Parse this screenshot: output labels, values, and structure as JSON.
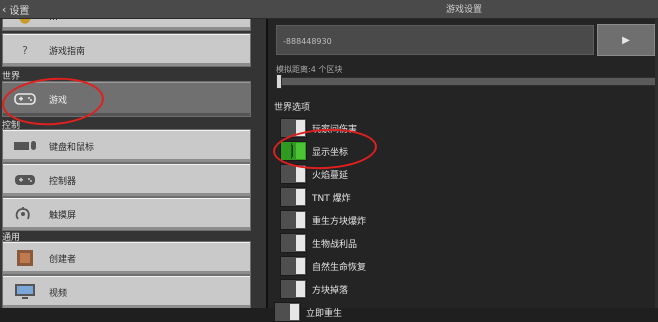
{
  "header": {
    "back_label": "设置",
    "title": "游戏设置"
  },
  "sidebar": {
    "partial_top": "…",
    "guide": "游戏指南",
    "section_world": "世界",
    "game": "游戏",
    "section_control": "控制",
    "keyboard_mouse": "键盘和鼠标",
    "controller": "控制器",
    "touchscreen": "触摸屏",
    "section_general": "通用",
    "creator": "创建者",
    "video": "视频"
  },
  "main": {
    "seed_value": "-888448930",
    "sim_distance_label": "模拟距离:4 个区块",
    "sim_distance_value": 0,
    "world_options_label": "世界选项",
    "options": [
      {
        "label": "玩家间伤害",
        "on": false
      },
      {
        "label": "显示坐标",
        "on": true
      },
      {
        "label": "火焰蔓延",
        "on": false
      },
      {
        "label": "TNT 爆炸",
        "on": false
      },
      {
        "label": "重生方块爆炸",
        "on": false
      },
      {
        "label": "生物战利品",
        "on": false
      },
      {
        "label": "自然生命恢复",
        "on": false
      },
      {
        "label": "方块掉落",
        "on": false
      },
      {
        "label": "立即重生",
        "on": false
      }
    ]
  },
  "colors": {
    "annotation": "#e0201e",
    "toggle_on": "#2f9a1f"
  },
  "icons": {
    "guide": "question-icon",
    "game": "gamepad-icon",
    "keyboard": "keyboard-mouse-icon",
    "controller": "controller-icon",
    "touch": "touch-icon",
    "creator": "creator-icon",
    "video": "monitor-icon",
    "go": "play-arrow-icon"
  }
}
